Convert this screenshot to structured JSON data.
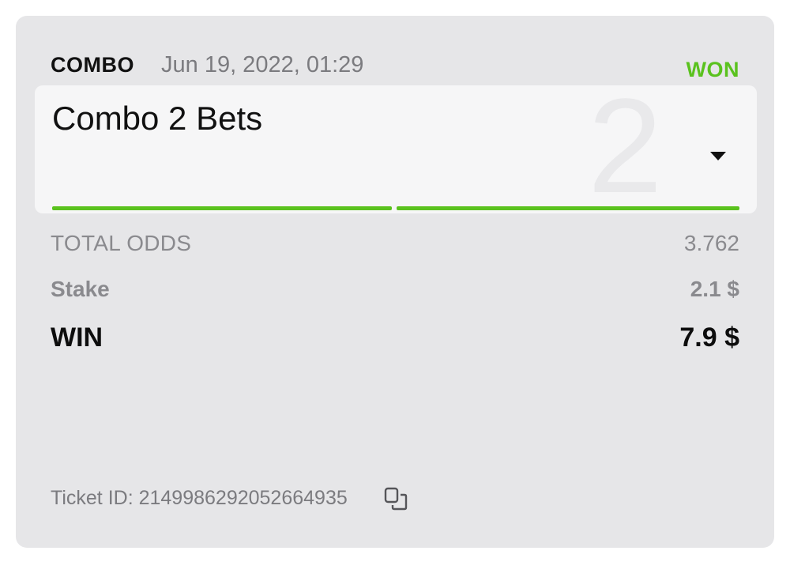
{
  "header": {
    "bet_type": "COMBO",
    "date": "Jun 19, 2022, 01:29",
    "status": "WON",
    "status_color": "#5ac21e"
  },
  "combo": {
    "title": "Combo 2 Bets",
    "count_watermark": "2",
    "legs_won": 2,
    "legs_total": 2
  },
  "summary": {
    "total_odds_label": "TOTAL ODDS",
    "total_odds_value": "3.762",
    "stake_label": "Stake",
    "stake_value": "2.1 $",
    "win_label": "WIN",
    "win_value": "7.9 $"
  },
  "ticket": {
    "text": "Ticket ID: 2149986292052664935",
    "copy_icon": "copy-icon"
  }
}
